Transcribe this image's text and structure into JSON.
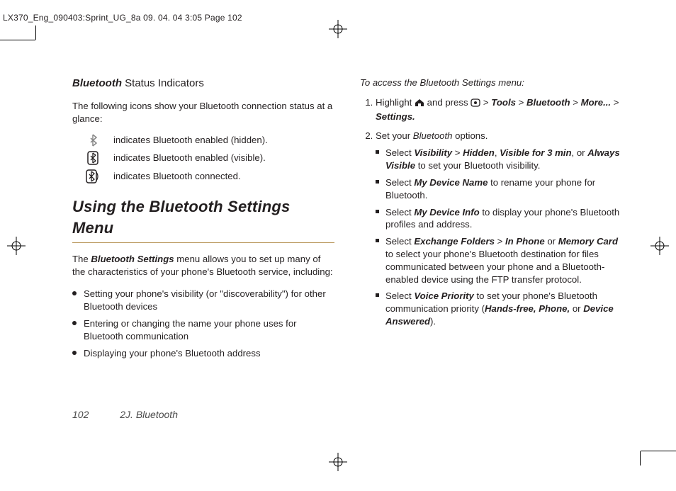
{
  "crop_header": "LX370_Eng_090403:Sprint_UG_8a  09. 04. 04    3:05  Page 102",
  "left": {
    "status_heading_bi": "Bluetooth",
    "status_heading_rest": " Status Indicators",
    "status_intro": "The following icons show your Bluetooth connection status at a glance:",
    "rows": {
      "r1": "indicates Bluetooth enabled (hidden).",
      "r2": "indicates Bluetooth enabled (visible).",
      "r3": "indicates Bluetooth connected."
    },
    "section_title": "Using the Bluetooth Settings Menu",
    "settings_intro_pre": "The ",
    "settings_intro_bi": "Bluetooth Settings",
    "settings_intro_post": " menu allows you to set up many of the characteristics of your phone's Bluetooth service, including:",
    "bullets": {
      "b1": "Setting your phone's visibility (or \"discoverability\") for other Bluetooth devices",
      "b2": "Entering or changing the name your phone uses for Bluetooth communication",
      "b3": "Displaying your phone's Bluetooth address"
    }
  },
  "right": {
    "lead": "To access the Bluetooth Settings menu:",
    "s1_pre": "Highlight ",
    "s1_mid": " and press ",
    "s1_keys_a": " > ",
    "s1_k1": "Tools",
    "s1_k2": "Bluetooth",
    "s1_k3": "More...",
    "s1_k4": "Settings.",
    "s2_pre": "Set your ",
    "s2_bi": "Bluetooth",
    "s2_post": " options.",
    "sub": {
      "a_pre": "Select ",
      "a_k1": "Visibility",
      "a_gt": " > ",
      "a_k2": "Hidden",
      "a_mid1": ", ",
      "a_k3": "Visible for 3 min",
      "a_mid2": ", or ",
      "a_k4": "Always Visible",
      "a_post": " to set your Bluetooth visibility.",
      "b_pre": "Select ",
      "b_k1": "My Device Name",
      "b_post": " to rename your phone for Bluetooth.",
      "c_pre": "Select ",
      "c_k1": "My Device Info",
      "c_post": " to display your phone's Bluetooth profiles and address.",
      "d_pre": "Select ",
      "d_k1": "Exchange Folders",
      "d_gt": " > ",
      "d_k2": " In Phone",
      "d_mid": " or ",
      "d_k3": "Memory Card",
      "d_post": " to select your phone's Bluetooth destination for files communicated between your phone and a Bluetooth-enabled device using the FTP transfer protocol.",
      "e_pre": "Select ",
      "e_k1": "Voice Priority",
      "e_mid": " to set your phone's Bluetooth communication priority (",
      "e_k2": "Hands-free, Phone,",
      "e_mid2": " or ",
      "e_k3": "Device Answered",
      "e_post": ")."
    }
  },
  "footer": {
    "page": "102",
    "section": "2J. Bluetooth"
  }
}
